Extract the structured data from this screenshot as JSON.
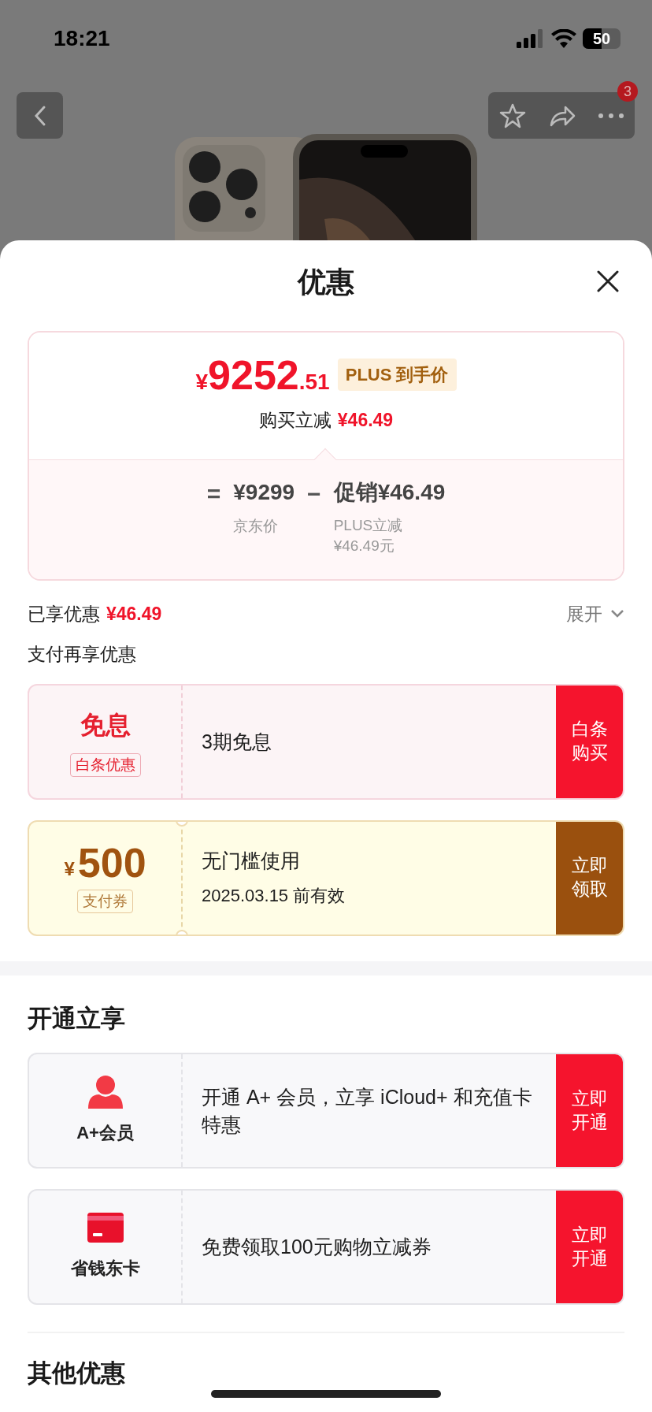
{
  "status_bar": {
    "time": "18:21",
    "battery": "50"
  },
  "nav": {
    "badge": "3"
  },
  "sheet": {
    "title": "优惠"
  },
  "price_card": {
    "currency": "¥",
    "price_int": "9252",
    "price_dec": ".51",
    "tag": "PLUS 到手价",
    "saving_label": "购买立减",
    "saving_value": "¥46.49",
    "breakdown": {
      "equals": "=",
      "base": "¥9299",
      "base_label": "京东价",
      "minus": "−",
      "promo": "促销¥46.49",
      "promo_label": [
        "PLUS立减",
        "¥46.49元"
      ]
    }
  },
  "enjoyed": {
    "label": "已享优惠",
    "value": "¥46.49",
    "expand": "展开"
  },
  "pay_section": {
    "title": "支付再享优惠",
    "offers": [
      {
        "kind": "interest_free",
        "title": "免息",
        "tag": "白条优惠",
        "text": "3期免息",
        "button": [
          "白条",
          "购买"
        ]
      },
      {
        "kind": "coupon",
        "currency": "¥",
        "amount": "500",
        "tag": "支付券",
        "text": "无门槛使用",
        "subtext": "2025.03.15 前有效",
        "button": [
          "立即",
          "领取"
        ]
      }
    ]
  },
  "member_section": {
    "title": "开通立享",
    "items": [
      {
        "kind": "member",
        "label": "A+会员",
        "text": "开通 A+ 会员，立享 iCloud+ 和充值卡特惠",
        "button": [
          "立即",
          "开通"
        ]
      },
      {
        "kind": "card",
        "label": "省钱东卡",
        "text": "免费领取100元购物立减券",
        "button": [
          "立即",
          "开通"
        ]
      }
    ]
  },
  "other_section": {
    "title": "其他优惠"
  }
}
